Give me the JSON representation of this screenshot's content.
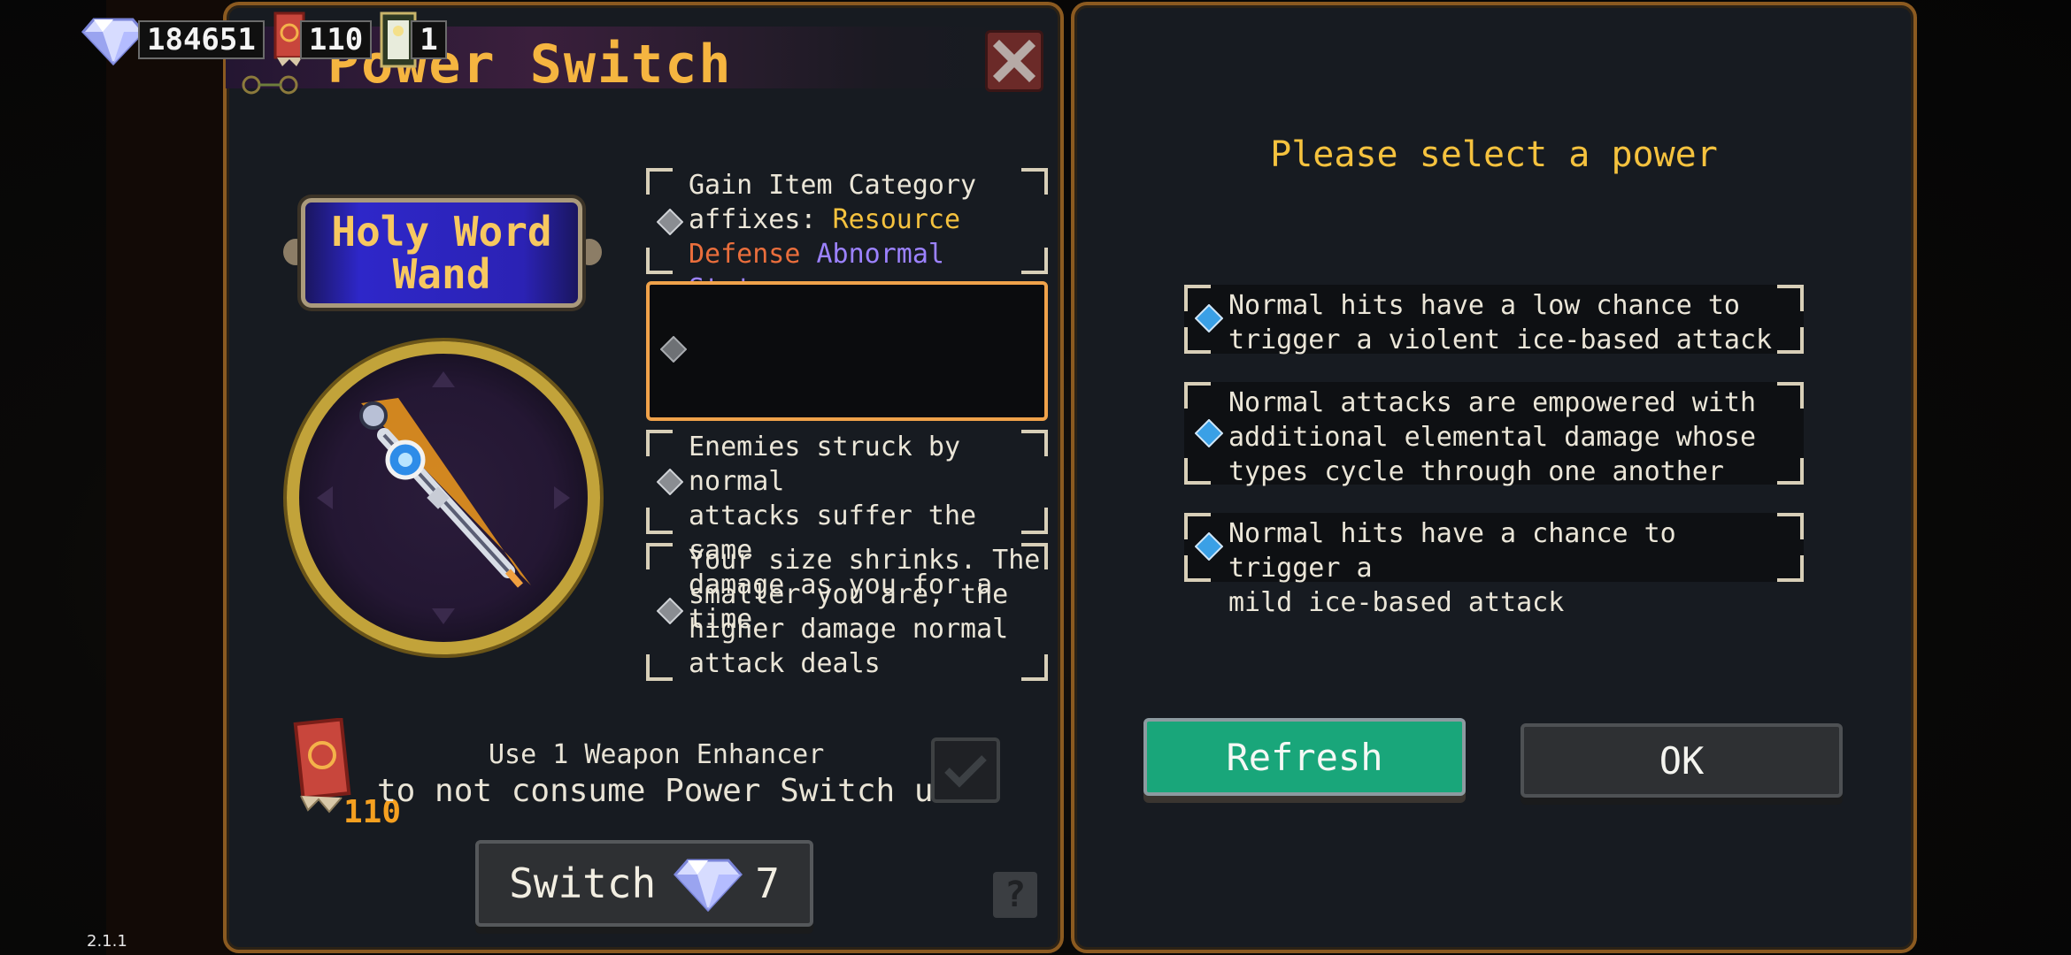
{
  "resources": {
    "gems": "184651",
    "enhancers": "110",
    "cards": "1"
  },
  "title": "Power Switch",
  "weapon": {
    "name_line1": "Holy Word",
    "name_line2": "Wand"
  },
  "affixes": [
    {
      "line1": "Gain Item Category",
      "line2_prefix": "affixes: ",
      "tag1": "Resource",
      "tag2": "Defense",
      "tag3": "Abnormal Status"
    },
    {
      "text": ""
    },
    {
      "lines": [
        "Enemies struck by normal",
        "attacks suffer the same",
        "damage as you for a time"
      ]
    },
    {
      "lines": [
        "Your size shrinks. The",
        "smaller you are, the",
        "higher damage normal",
        "attack deals"
      ]
    }
  ],
  "enhancer": {
    "count": "110",
    "line1": "Use 1 Weapon Enhancer",
    "line2": "to not consume Power Switch uses",
    "checked": true
  },
  "switch_button": {
    "label": "Switch",
    "cost": "7"
  },
  "help_label": "?",
  "right": {
    "title": "Please select a power",
    "powers": [
      {
        "lines": [
          "Normal hits have a low chance to",
          "trigger a violent ice-based attack"
        ]
      },
      {
        "lines": [
          "Normal attacks are empowered with",
          "additional elemental damage whose",
          "types cycle through one another"
        ]
      },
      {
        "lines": [
          "Normal hits have a chance to trigger a",
          "mild ice-based attack"
        ]
      }
    ],
    "refresh_label": "Refresh",
    "ok_label": "OK"
  },
  "version": "2.1.1",
  "colors": {
    "accent_gold": "#f5c23e",
    "panel_border": "#8b5a20",
    "refresh_green": "#19a67a",
    "tag_resource": "#f5c23e",
    "tag_defense": "#ea6e3c",
    "tag_abnormal": "#9c82ff"
  }
}
